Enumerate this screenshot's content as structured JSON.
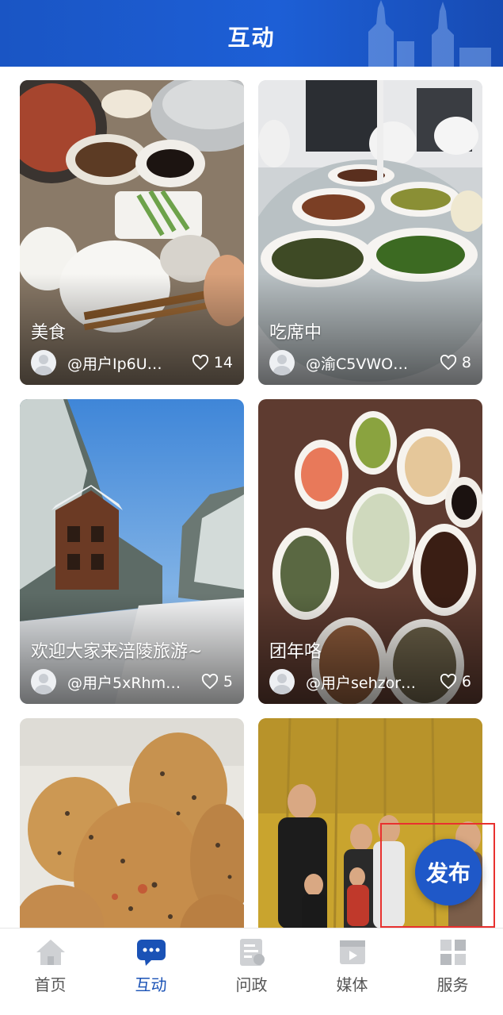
{
  "header": {
    "title": "互动"
  },
  "feed": {
    "posts": [
      {
        "caption": "美食",
        "user": "@用户Ip6U…",
        "likes": "14",
        "photo_theme": "hotpot-dinner"
      },
      {
        "caption": "吃席中",
        "user": "@渝C5VWO…",
        "likes": "8",
        "photo_theme": "banquet-table"
      },
      {
        "caption": "欢迎大家来涪陵旅游~",
        "user": "@用户5xRhm…",
        "likes": "5",
        "photo_theme": "snowy-forest-cabin"
      },
      {
        "caption": "团年咯",
        "user": "@用户sehzor…",
        "likes": "6",
        "photo_theme": "new-year-feast"
      },
      {
        "caption": "",
        "user": "",
        "likes": "",
        "photo_theme": "potatoes"
      },
      {
        "caption": "",
        "user": "",
        "likes": "",
        "photo_theme": "family-gathering-yurt"
      }
    ]
  },
  "fab": {
    "label": "发布"
  },
  "tabbar": {
    "items": [
      {
        "label": "首页",
        "icon": "home-icon",
        "active": false
      },
      {
        "label": "互动",
        "icon": "chat-icon",
        "active": true
      },
      {
        "label": "问政",
        "icon": "inquiry-icon",
        "active": false
      },
      {
        "label": "媒体",
        "icon": "video-icon",
        "active": false
      },
      {
        "label": "服务",
        "icon": "grid-icon",
        "active": false
      }
    ]
  },
  "colors": {
    "brand_blue": "#1a52b6",
    "header_blue": "#1d5fd6",
    "highlight_red": "#e8312f"
  }
}
